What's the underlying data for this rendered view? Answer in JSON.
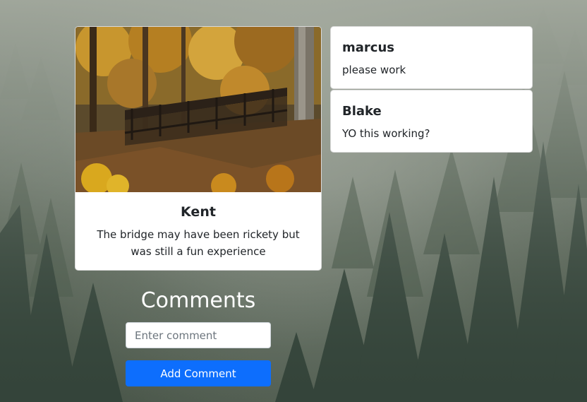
{
  "post": {
    "author": "Kent",
    "text": "The bridge may have been rickety but was still a fun experience"
  },
  "comments": [
    {
      "author": "marcus",
      "text": "please work"
    },
    {
      "author": "Blake",
      "text": "YO this working?"
    }
  ],
  "form": {
    "heading": "Comments",
    "input_placeholder": "Enter comment",
    "input_value": "",
    "submit_label": "Add Comment"
  },
  "colors": {
    "primary_button": "#0d6efd",
    "card_background": "#ffffff",
    "heading_text": "#ffffff"
  }
}
